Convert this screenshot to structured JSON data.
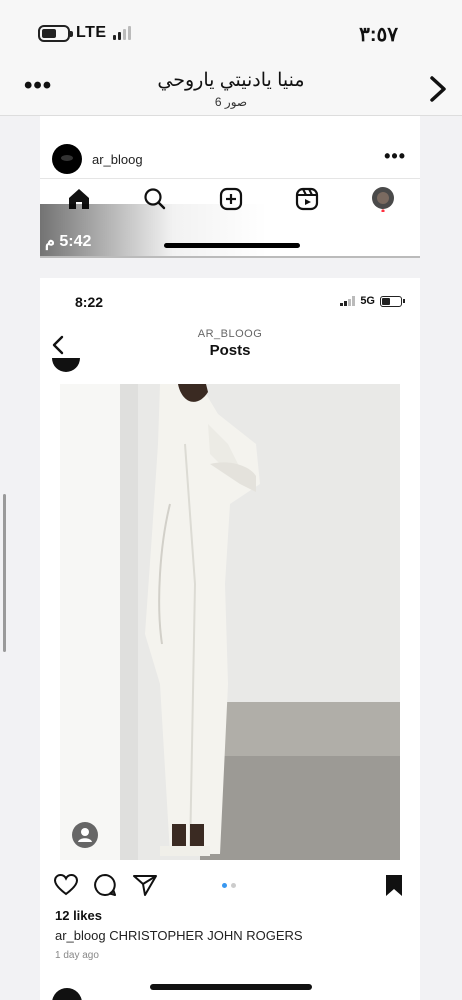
{
  "status_bar": {
    "network": "LTE",
    "time": "٣:٥٧"
  },
  "nav": {
    "more": "•••",
    "title": "منيا يادنيتي ياروحي",
    "subtitle": "6 صور"
  },
  "photo1": {
    "username": "ar_bloog",
    "more": "•••",
    "timestamp": "5:42 م"
  },
  "photo2": {
    "time": "8:22",
    "network": "5G",
    "profile": "AR_BLOOG",
    "page_title": "Posts",
    "likes": "12 likes",
    "caption_user": "ar_bloog",
    "caption_text": "CHRISTOPHER JOHN ROGERS",
    "posted": "1 day ago"
  },
  "colors": {
    "accent": "#3897f0",
    "background": "#f2f2f4"
  }
}
